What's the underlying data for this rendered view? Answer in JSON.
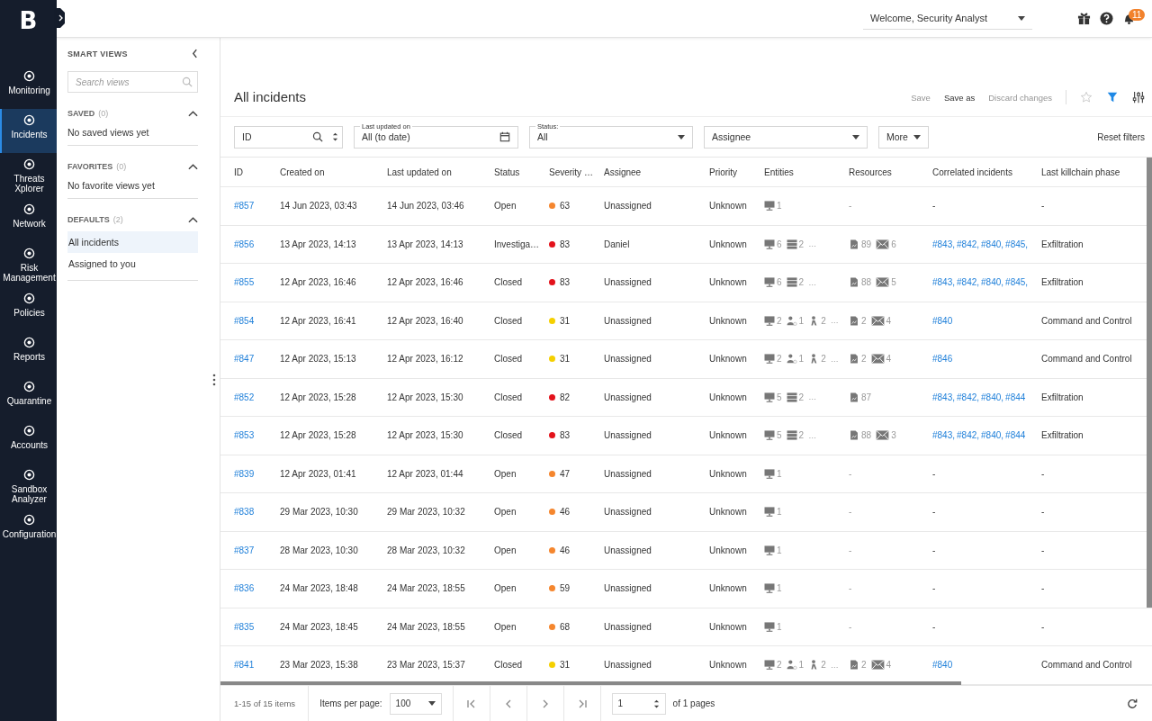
{
  "nav": {
    "logo": "B",
    "items": [
      {
        "label": "Monitoring",
        "selected": false
      },
      {
        "label": "Incidents",
        "selected": true
      },
      {
        "label": "Threats Xplorer",
        "selected": false
      },
      {
        "label": "Network",
        "selected": false
      },
      {
        "label": "Risk Management",
        "selected": false
      },
      {
        "label": "Policies",
        "selected": false
      },
      {
        "label": "Reports",
        "selected": false
      },
      {
        "label": "Quarantine",
        "selected": false
      },
      {
        "label": "Accounts",
        "selected": false
      },
      {
        "label": "Sandbox Analyzer",
        "selected": false
      },
      {
        "label": "Configuration",
        "selected": false
      }
    ]
  },
  "top_bar": {
    "user_menu": "Welcome, Security Analyst",
    "notifications_badge": "11"
  },
  "smart_views": {
    "title": "SMART VIEWS",
    "search": {
      "placeholder": "Search views"
    },
    "sections": [
      {
        "title": "SAVED",
        "count": "(0)",
        "expanded": true,
        "empty_text": "No saved views yet"
      },
      {
        "title": "FAVORITES",
        "count": "(0)",
        "expanded": true,
        "empty_text": "No favorite views yet"
      },
      {
        "title": "DEFAULTS",
        "count": "(2)",
        "expanded": true,
        "items": [
          {
            "label": "All incidents",
            "selected": true
          },
          {
            "label": "Assigned to you",
            "selected": false
          }
        ]
      }
    ]
  },
  "page": {
    "title": "All incidents",
    "actions": [
      {
        "label": "Save",
        "disabled": true
      },
      {
        "label": "Save as",
        "disabled": false
      },
      {
        "label": "Discard changes",
        "disabled": true
      }
    ]
  },
  "filters": {
    "id": {
      "placeholder": "ID"
    },
    "last_updated": {
      "label": "Last updated on",
      "value": "All (to date)"
    },
    "status": {
      "label": "Status:",
      "value": "All"
    },
    "assignee": {
      "value": "Assignee"
    },
    "more": "More",
    "reset": "Reset filters"
  },
  "table": {
    "columns": [
      "ID",
      "Created on",
      "Last updated on",
      "Status",
      "Severity …",
      "Assignee",
      "Priority",
      "Entities",
      "Resources",
      "Correlated incidents",
      "Last killchain phase"
    ],
    "rows": [
      {
        "id": "#857",
        "created": "14 Jun 2023, 03:43",
        "updated": "14 Jun 2023, 03:46",
        "status": "Open",
        "severity": "63",
        "color": "#f5862e",
        "assignee": "Unassigned",
        "priority": "Unknown",
        "entities": [
          {
            "kind": "endpoint",
            "count": "1"
          }
        ],
        "resources_empty": "-",
        "correlated_empty": "-",
        "killchain": "-"
      },
      {
        "id": "#856",
        "created": "13 Apr 2023, 14:13",
        "updated": "13 Apr 2023, 14:13",
        "status": "Investiga…",
        "severity": "83",
        "color": "#e3121b",
        "assignee": "Daniel",
        "priority": "Unknown",
        "entities": [
          {
            "kind": "endpoint",
            "count": "6"
          },
          {
            "kind": "server",
            "count": "2"
          }
        ],
        "entities_more": "…",
        "resources": [
          {
            "kind": "file",
            "count": "89"
          },
          {
            "kind": "mail",
            "count": "6"
          }
        ],
        "correlated": [
          "#843,",
          "#842,",
          "#840,",
          "#845,"
        ],
        "killchain": "Exfiltration"
      },
      {
        "id": "#855",
        "created": "12 Apr 2023, 16:46",
        "updated": "12 Apr 2023, 16:46",
        "status": "Closed",
        "severity": "83",
        "color": "#e3121b",
        "assignee": "Unassigned",
        "priority": "Unknown",
        "entities": [
          {
            "kind": "endpoint",
            "count": "6"
          },
          {
            "kind": "server",
            "count": "2"
          }
        ],
        "entities_more": "…",
        "resources": [
          {
            "kind": "file",
            "count": "88"
          },
          {
            "kind": "mail",
            "count": "5"
          }
        ],
        "correlated": [
          "#843,",
          "#842,",
          "#840,",
          "#845,"
        ],
        "killchain": "Exfiltration"
      },
      {
        "id": "#854",
        "created": "12 Apr 2023, 16:41",
        "updated": "12 Apr 2023, 16:40",
        "status": "Closed",
        "severity": "31",
        "color": "#f5d000",
        "assignee": "Unassigned",
        "priority": "Unknown",
        "entities": [
          {
            "kind": "endpoint",
            "count": "2"
          },
          {
            "kind": "account",
            "count": "1"
          },
          {
            "kind": "user",
            "count": "2"
          }
        ],
        "entities_more": "…",
        "resources": [
          {
            "kind": "file",
            "count": "2"
          },
          {
            "kind": "mail",
            "count": "4"
          }
        ],
        "correlated": [
          "#840"
        ],
        "killchain": "Command and Control"
      },
      {
        "id": "#847",
        "created": "12 Apr 2023, 15:13",
        "updated": "12 Apr 2023, 16:12",
        "status": "Closed",
        "severity": "31",
        "color": "#f5d000",
        "assignee": "Unassigned",
        "priority": "Unknown",
        "entities": [
          {
            "kind": "endpoint",
            "count": "2"
          },
          {
            "kind": "account",
            "count": "1"
          },
          {
            "kind": "user",
            "count": "2"
          }
        ],
        "entities_more": "…",
        "resources": [
          {
            "kind": "file",
            "count": "2"
          },
          {
            "kind": "mail",
            "count": "4"
          }
        ],
        "correlated": [
          "#846"
        ],
        "killchain": "Command and Control"
      },
      {
        "id": "#852",
        "created": "12 Apr 2023, 15:28",
        "updated": "12 Apr 2023, 15:30",
        "status": "Closed",
        "severity": "82",
        "color": "#e3121b",
        "assignee": "Unassigned",
        "priority": "Unknown",
        "entities": [
          {
            "kind": "endpoint",
            "count": "5"
          },
          {
            "kind": "server",
            "count": "2"
          }
        ],
        "entities_more": "…",
        "resources": [
          {
            "kind": "file",
            "count": "87"
          }
        ],
        "correlated": [
          "#843,",
          "#842,",
          "#840,",
          "#844"
        ],
        "killchain": "Exfiltration"
      },
      {
        "id": "#853",
        "created": "12 Apr 2023, 15:28",
        "updated": "12 Apr 2023, 15:30",
        "status": "Closed",
        "severity": "83",
        "color": "#e3121b",
        "assignee": "Unassigned",
        "priority": "Unknown",
        "entities": [
          {
            "kind": "endpoint",
            "count": "5"
          },
          {
            "kind": "server",
            "count": "2"
          }
        ],
        "entities_more": "…",
        "resources": [
          {
            "kind": "file",
            "count": "88"
          },
          {
            "kind": "mail",
            "count": "3"
          }
        ],
        "correlated": [
          "#843,",
          "#842,",
          "#840,",
          "#844"
        ],
        "killchain": "Exfiltration"
      },
      {
        "id": "#839",
        "created": "12 Apr 2023, 01:41",
        "updated": "12 Apr 2023, 01:44",
        "status": "Open",
        "severity": "47",
        "color": "#f5862e",
        "assignee": "Unassigned",
        "priority": "Unknown",
        "entities": [
          {
            "kind": "endpoint",
            "count": "1"
          }
        ],
        "resources_empty": "-",
        "correlated_empty": "-",
        "killchain": "-"
      },
      {
        "id": "#838",
        "created": "29 Mar 2023, 10:30",
        "updated": "29 Mar 2023, 10:32",
        "status": "Open",
        "severity": "46",
        "color": "#f5862e",
        "assignee": "Unassigned",
        "priority": "Unknown",
        "entities": [
          {
            "kind": "endpoint",
            "count": "1"
          }
        ],
        "resources_empty": "-",
        "correlated_empty": "-",
        "killchain": "-"
      },
      {
        "id": "#837",
        "created": "28 Mar 2023, 10:30",
        "updated": "28 Mar 2023, 10:32",
        "status": "Open",
        "severity": "46",
        "color": "#f5862e",
        "assignee": "Unassigned",
        "priority": "Unknown",
        "entities": [
          {
            "kind": "endpoint",
            "count": "1"
          }
        ],
        "resources_empty": "-",
        "correlated_empty": "-",
        "killchain": "-"
      },
      {
        "id": "#836",
        "created": "24 Mar 2023, 18:48",
        "updated": "24 Mar 2023, 18:55",
        "status": "Open",
        "severity": "59",
        "color": "#f5862e",
        "assignee": "Unassigned",
        "priority": "Unknown",
        "entities": [
          {
            "kind": "endpoint",
            "count": "1"
          }
        ],
        "resources_empty": "-",
        "correlated_empty": "-",
        "killchain": "-"
      },
      {
        "id": "#835",
        "created": "24 Mar 2023, 18:45",
        "updated": "24 Mar 2023, 18:55",
        "status": "Open",
        "severity": "68",
        "color": "#f5862e",
        "assignee": "Unassigned",
        "priority": "Unknown",
        "entities": [
          {
            "kind": "endpoint",
            "count": "1"
          }
        ],
        "resources_empty": "-",
        "correlated_empty": "-",
        "killchain": "-"
      },
      {
        "id": "#841",
        "created": "23 Mar 2023, 15:38",
        "updated": "23 Mar 2023, 15:37",
        "status": "Closed",
        "severity": "31",
        "color": "#f5d000",
        "assignee": "Unassigned",
        "priority": "Unknown",
        "entities": [
          {
            "kind": "endpoint",
            "count": "2"
          },
          {
            "kind": "account",
            "count": "1"
          },
          {
            "kind": "user",
            "count": "2"
          }
        ],
        "entities_more": "…",
        "resources": [
          {
            "kind": "file",
            "count": "2"
          },
          {
            "kind": "mail",
            "count": "4"
          }
        ],
        "correlated": [
          "#840"
        ],
        "killchain": "Command and Control"
      }
    ]
  },
  "pagination": {
    "summary": "1-15 of 15 items",
    "items_per_page_label": "Items per page:",
    "items_per_page": "100",
    "page": "1",
    "of_pages": "of 1 pages"
  }
}
